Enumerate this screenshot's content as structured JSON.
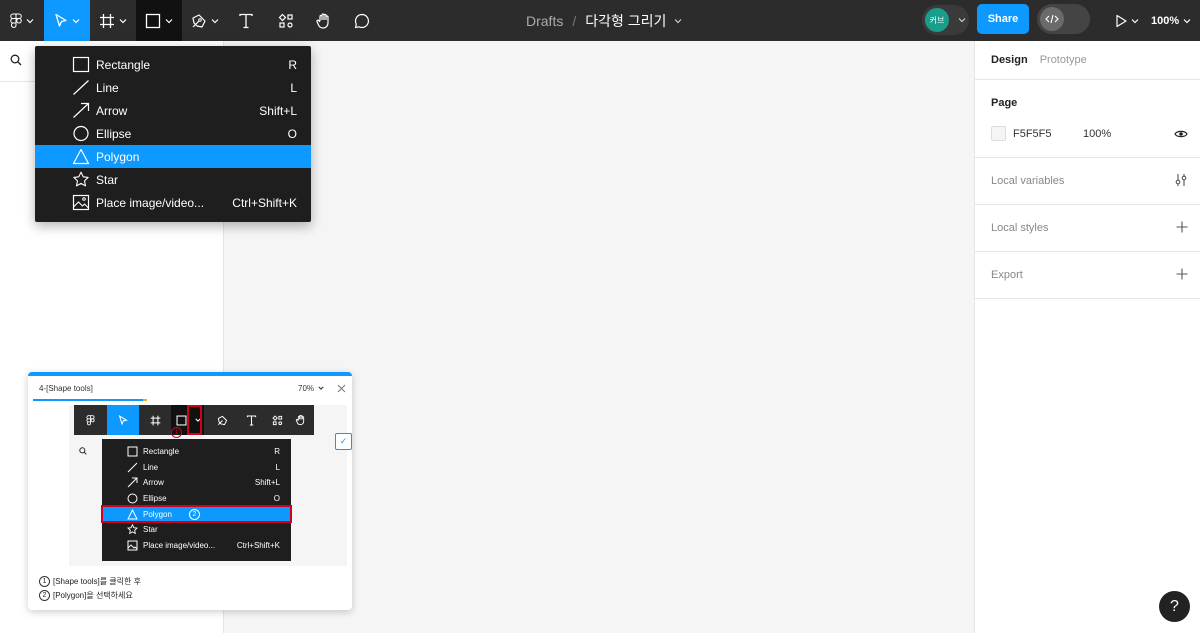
{
  "toolbar": {
    "breadcrumb_root": "Drafts",
    "separator": "/",
    "file_name": "다각형 그리기",
    "avatar_initials": "커브",
    "share_label": "Share",
    "zoom_label": "100%"
  },
  "left_panel": {
    "search_icon": "search-icon"
  },
  "menu": {
    "items": [
      {
        "label": "Rectangle",
        "shortcut": "R",
        "icon": "rectangle-icon"
      },
      {
        "label": "Line",
        "shortcut": "L",
        "icon": "line-icon"
      },
      {
        "label": "Arrow",
        "shortcut": "Shift+L",
        "icon": "arrow-icon"
      },
      {
        "label": "Ellipse",
        "shortcut": "O",
        "icon": "ellipse-icon"
      },
      {
        "label": "Polygon",
        "shortcut": "",
        "icon": "polygon-icon",
        "selected": true
      },
      {
        "label": "Star",
        "shortcut": "",
        "icon": "star-icon"
      },
      {
        "label": "Place image/video...",
        "shortcut": "Ctrl+Shift+K",
        "icon": "image-icon"
      }
    ]
  },
  "right_panel": {
    "tabs": [
      "Design",
      "Prototype"
    ],
    "page_label": "Page",
    "page_color": "F5F5F5",
    "page_opacity": "100%",
    "local_variables": "Local variables",
    "local_styles": "Local styles",
    "export": "Export"
  },
  "tutorial": {
    "title": "4-[Shape tools]",
    "zoom": "70%",
    "progress": 0.35,
    "marker_1": "1",
    "marker_2": "2",
    "menu_items": [
      {
        "label": "Rectangle",
        "shortcut": "R"
      },
      {
        "label": "Line",
        "shortcut": "L"
      },
      {
        "label": "Arrow",
        "shortcut": "Shift+L"
      },
      {
        "label": "Ellipse",
        "shortcut": "O"
      },
      {
        "label": "Polygon",
        "shortcut": ""
      },
      {
        "label": "Star",
        "shortcut": ""
      },
      {
        "label": "Place image/video...",
        "shortcut": "Ctrl+Shift+K"
      }
    ],
    "step1_num": "1",
    "step1_text": "[Shape tools]를 클릭한 후",
    "step2_num": "2",
    "step2_text": "[Polygon]을 선택하세요"
  },
  "help": {
    "label": "?"
  },
  "colors": {
    "accent": "#0d99ff",
    "toolbar": "#2c2c2c",
    "highlight": "#d0021b"
  }
}
